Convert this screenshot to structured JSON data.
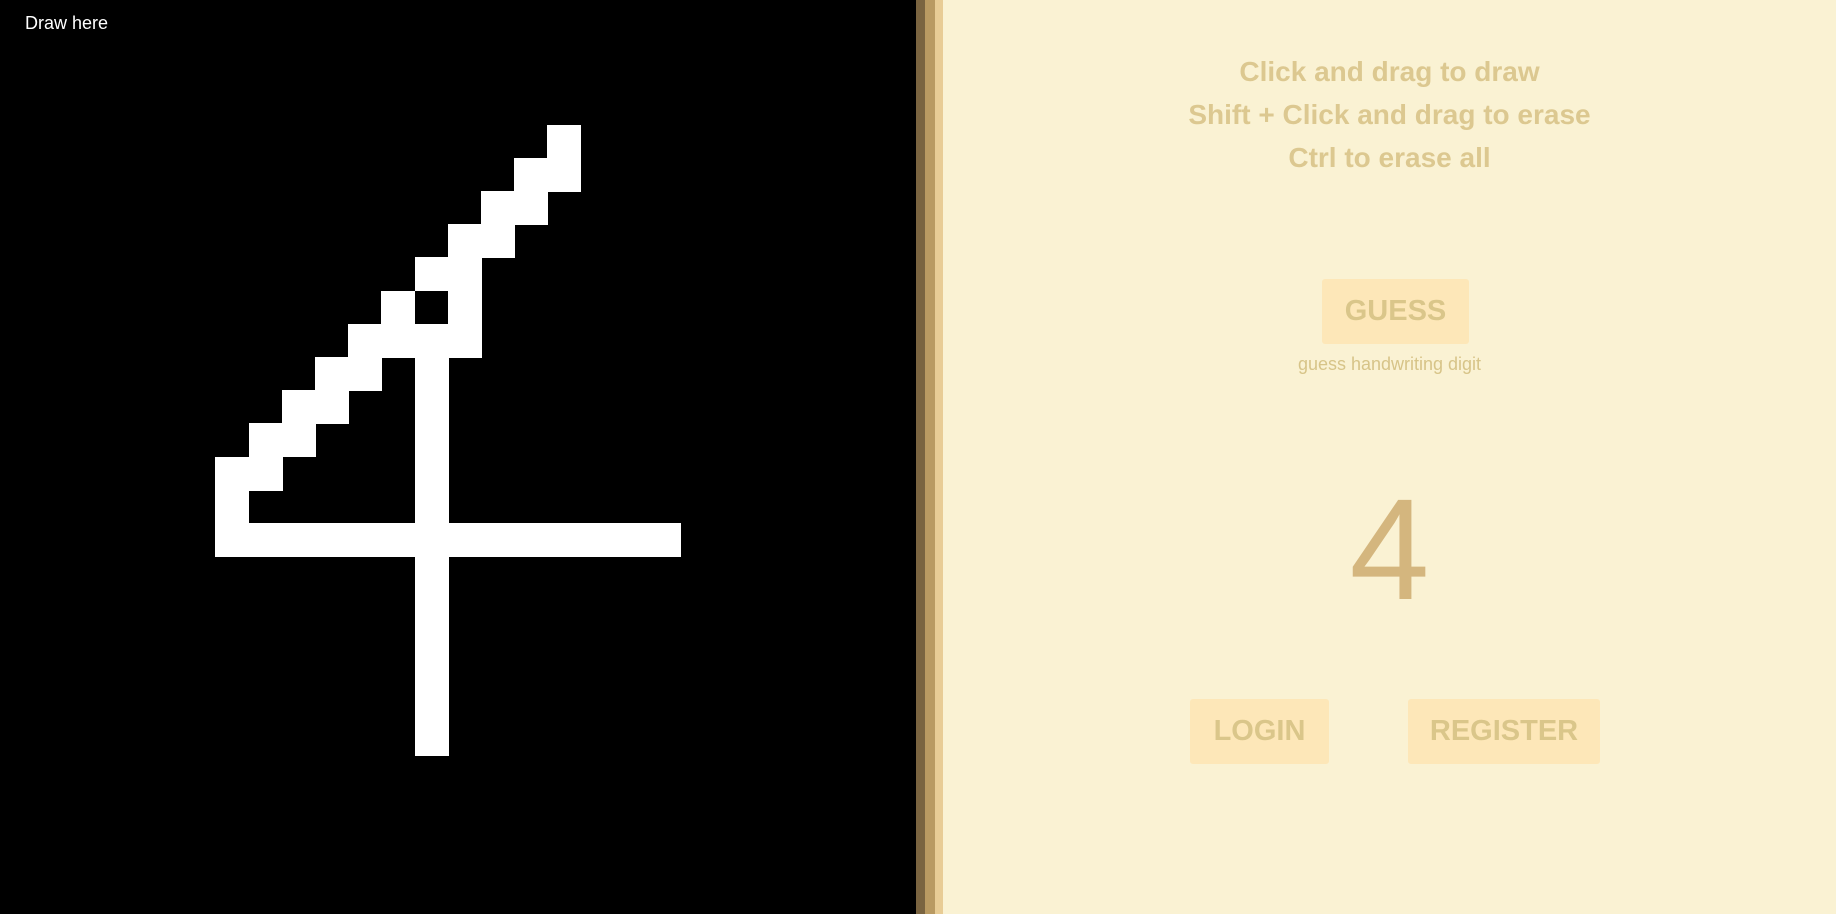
{
  "canvas": {
    "label": "Draw here",
    "background": "#000000",
    "ink_color": "#ffffff",
    "drawn_digit_cells": [
      [
        17,
        3
      ],
      [
        16,
        4
      ],
      [
        17,
        4
      ],
      [
        15,
        5
      ],
      [
        16,
        5
      ],
      [
        14,
        6
      ],
      [
        15,
        6
      ],
      [
        13,
        7
      ],
      [
        14,
        7
      ],
      [
        12,
        8
      ],
      [
        14,
        8
      ],
      [
        11,
        9
      ],
      [
        12,
        9
      ],
      [
        13,
        9
      ],
      [
        14,
        9
      ],
      [
        10,
        10
      ],
      [
        11,
        10
      ],
      [
        13,
        10
      ],
      [
        9,
        11
      ],
      [
        10,
        11
      ],
      [
        13,
        11
      ],
      [
        8,
        12
      ],
      [
        9,
        12
      ],
      [
        13,
        12
      ],
      [
        7,
        13
      ],
      [
        8,
        13
      ],
      [
        13,
        13
      ],
      [
        7,
        14
      ],
      [
        13,
        14
      ],
      [
        7,
        15
      ],
      [
        8,
        15
      ],
      [
        9,
        15
      ],
      [
        10,
        15
      ],
      [
        11,
        15
      ],
      [
        12,
        15
      ],
      [
        13,
        15
      ],
      [
        14,
        15
      ],
      [
        15,
        15
      ],
      [
        16,
        15
      ],
      [
        17,
        15
      ],
      [
        18,
        15
      ],
      [
        19,
        15
      ],
      [
        20,
        15
      ],
      [
        13,
        16
      ],
      [
        13,
        17
      ],
      [
        13,
        18
      ],
      [
        13,
        19
      ],
      [
        13,
        20
      ],
      [
        13,
        21
      ]
    ]
  },
  "instructions": [
    "Click and drag to draw",
    "Shift + Click and drag to erase",
    "Ctrl to erase all"
  ],
  "guess": {
    "button_label": "GUESS",
    "caption": "guess handwriting digit"
  },
  "result": {
    "digit": "4"
  },
  "auth": {
    "login_label": "LOGIN",
    "register_label": "REGISTER"
  },
  "colors": {
    "panel_bg": "#faf2d3",
    "button_bg": "#fde7b8",
    "button_text": "#dac68a",
    "result_text": "#d4b67e"
  }
}
